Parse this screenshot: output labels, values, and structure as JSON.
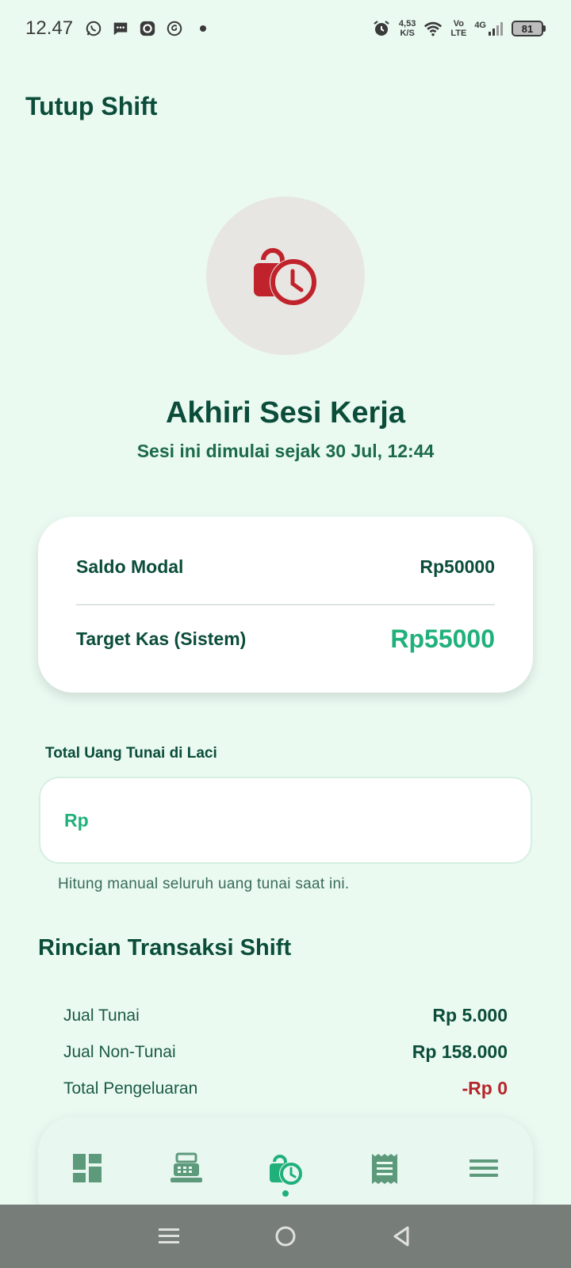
{
  "status_bar": {
    "time": "12.47",
    "net_speed_value": "4,53",
    "net_speed_unit": "K/S",
    "volte_top": "Vo",
    "volte_bottom": "LTE",
    "network": "4G",
    "battery": "81"
  },
  "header": {
    "title": "Tutup Shift"
  },
  "hero": {
    "icon": "lock-clock-icon",
    "title": "Akhiri Sesi Kerja",
    "subtitle": "Sesi ini dimulai sejak 30 Jul, 12:44"
  },
  "summary": {
    "opening_label": "Saldo Modal",
    "opening_value": "Rp50000",
    "target_label": "Target Kas (Sistem)",
    "target_value": "Rp55000"
  },
  "cash_input": {
    "label": "Total Uang Tunai di Laci",
    "prefix": "Rp",
    "value": "",
    "placeholder": "",
    "hint": "Hitung manual seluruh uang tunai saat ini."
  },
  "transactions": {
    "title": "Rincian Transaksi Shift",
    "rows": [
      {
        "label": "Jual Tunai",
        "value": "Rp 5.000"
      },
      {
        "label": "Jual Non-Tunai",
        "value": "Rp 158.000"
      },
      {
        "label": "Total Pengeluaran",
        "value": "-Rp 0"
      }
    ]
  },
  "bottom_nav": {
    "items": [
      "dashboard-icon",
      "cash-register-icon",
      "shift-clock-icon",
      "receipt-icon",
      "menu-icon"
    ],
    "active_index": 2
  },
  "colors": {
    "background": "#eafaf1",
    "primary_dark": "#0b4d3a",
    "accent": "#20b07a",
    "danger": "#b5262a"
  }
}
